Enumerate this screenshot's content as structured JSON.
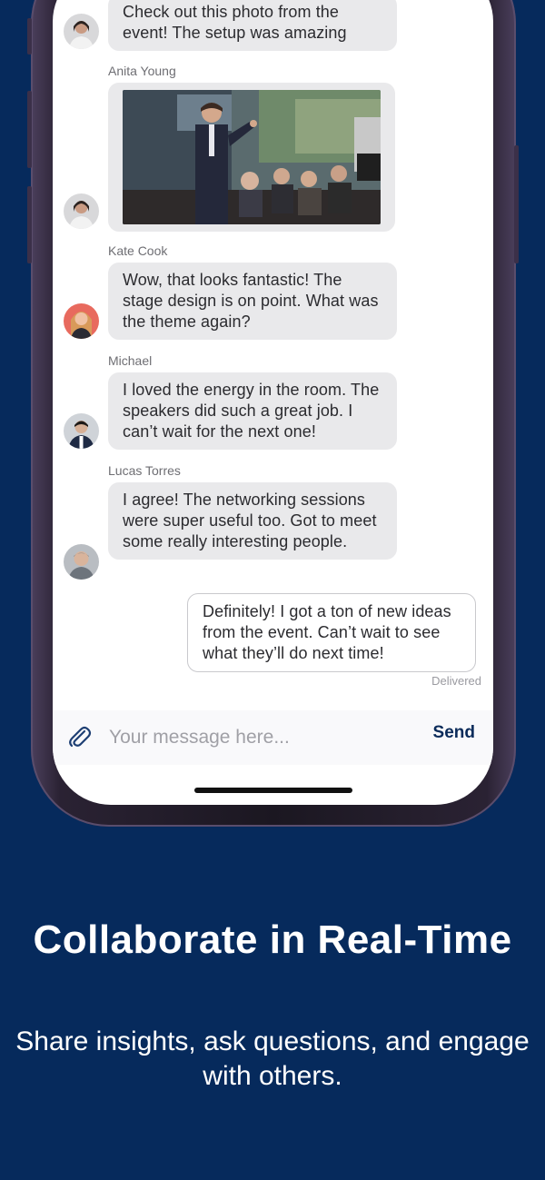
{
  "colors": {
    "background": "#062a5c",
    "bubble_incoming": "#e9e9eb",
    "send": "#0b2b5a"
  },
  "chat": {
    "messages": [
      {
        "author": "",
        "text": "Check out this photo from the event! The setup was amazing",
        "avatar": "woman-avatar"
      },
      {
        "author": "Anita Young",
        "type": "photo",
        "alt": "conference-photo",
        "avatar": "woman-avatar"
      },
      {
        "author": "Kate Cook",
        "text": "Wow, that looks fantastic! The stage design is on point. What was the theme again?",
        "avatar": "red-hair-avatar"
      },
      {
        "author": "Michael",
        "text": "I loved the energy in the room. The speakers did such a great job. I can’t wait for the next one!",
        "avatar": "man-avatar"
      },
      {
        "author": "Lucas Torres",
        "text": "I agree! The networking sessions were super useful too. Got to meet some really interesting people.",
        "avatar": "older-man-avatar"
      }
    ],
    "outgoing": {
      "text": "Definitely! I got a ton of new ideas from the event. Can’t wait to see what they’ll do next time!",
      "status": "Delivered"
    }
  },
  "composer": {
    "placeholder": "Your message here...",
    "send_label": "Send",
    "attach_icon": "paperclip-icon"
  },
  "promo": {
    "title": "Collaborate in Real-Time",
    "subtitle": "Share insights, ask questions, and engage with others."
  }
}
